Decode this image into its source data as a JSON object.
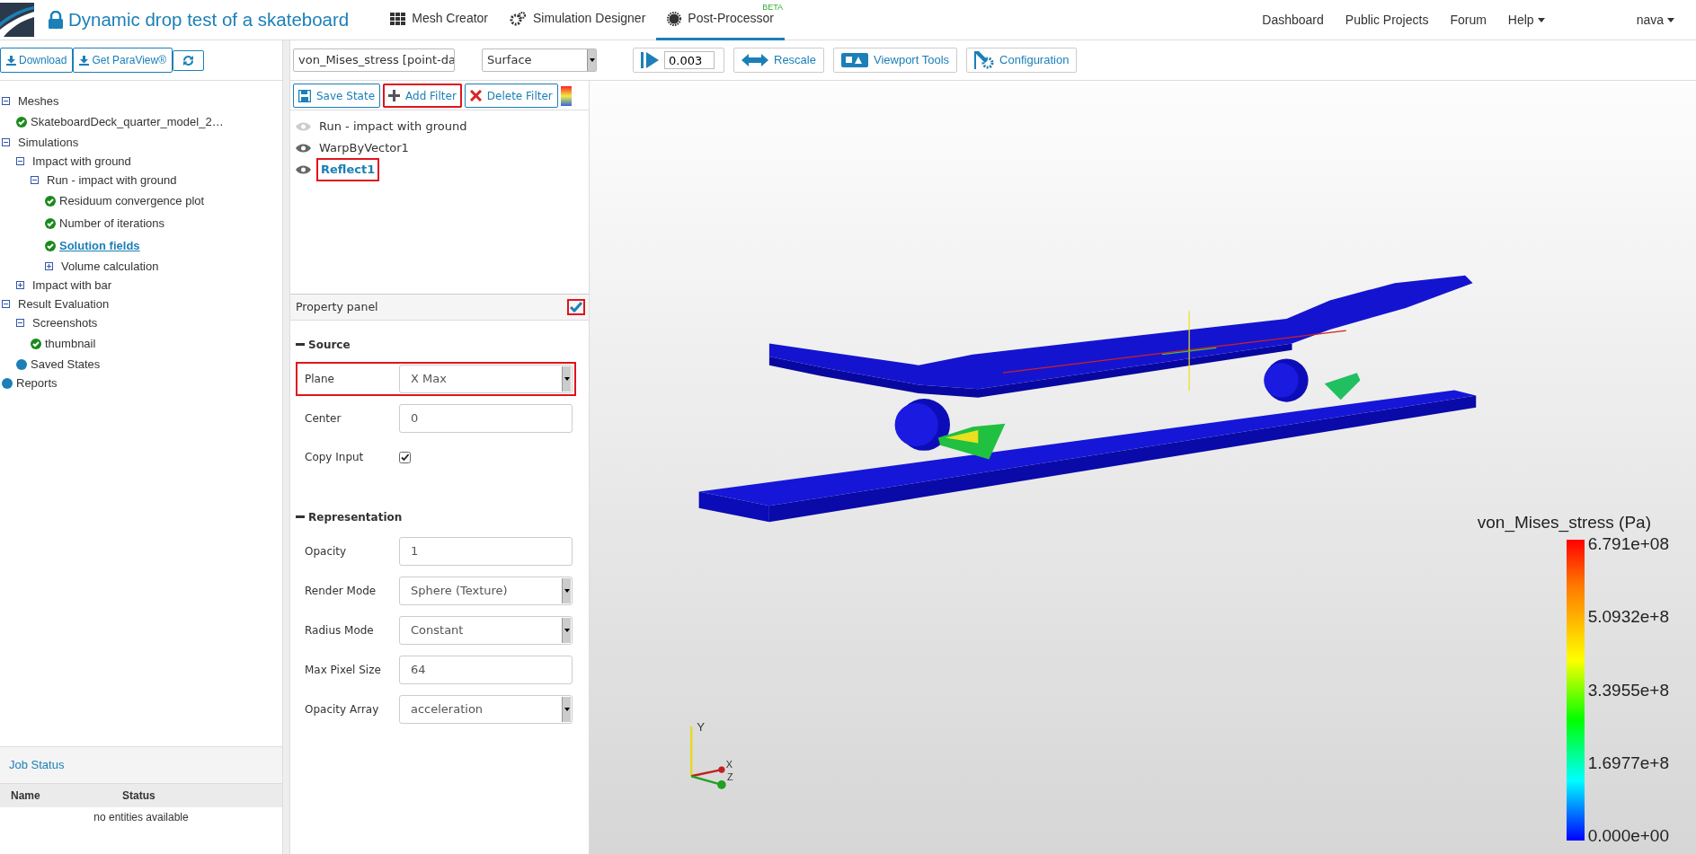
{
  "app": {
    "title": "Dynamic drop test of a skateboard",
    "locked": true
  },
  "modules": [
    {
      "label": "Mesh Creator",
      "selected": false
    },
    {
      "label": "Simulation Designer",
      "selected": false
    },
    {
      "label": "Post-Processor",
      "selected": true,
      "badge": "BETA"
    }
  ],
  "nav_links": [
    {
      "label": "Dashboard",
      "dropdown": false
    },
    {
      "label": "Public Projects",
      "dropdown": false
    },
    {
      "label": "Forum",
      "dropdown": false
    },
    {
      "label": "Help",
      "dropdown": true
    }
  ],
  "user": {
    "label": "nava",
    "dropdown": true
  },
  "sidebar": {
    "buttons": [
      {
        "kind": "labeled",
        "label": "Download"
      },
      {
        "kind": "labeled",
        "label": "Get ParaView®"
      },
      {
        "kind": "icon"
      }
    ],
    "tree": [
      {
        "label": "Meshes",
        "kind": "folder",
        "expanded": true,
        "selected": false,
        "children": [
          {
            "label": "SkateboardDeck_quarter_model_2…",
            "kind": "result",
            "selected": false
          }
        ]
      },
      {
        "label": "Simulations",
        "kind": "folder",
        "expanded": true,
        "selected": false,
        "children": [
          {
            "label": "Impact with ground",
            "kind": "folder",
            "expanded": true,
            "selected": false,
            "children": [
              {
                "label": "Run - impact with ground",
                "kind": "folder",
                "expanded": true,
                "selected": false,
                "children": [
                  {
                    "label": "Residuum convergence plot",
                    "kind": "result",
                    "selected": false
                  },
                  {
                    "label": "Number of iterations",
                    "kind": "result",
                    "selected": false
                  },
                  {
                    "label": "Solution fields",
                    "kind": "result",
                    "selected": true
                  },
                  {
                    "label": "Volume calculation",
                    "kind": "folder",
                    "expanded": false,
                    "selected": false
                  }
                ]
              }
            ]
          },
          {
            "label": "Impact with bar",
            "kind": "folder",
            "expanded": false,
            "selected": false
          }
        ]
      },
      {
        "label": "Result Evaluation",
        "kind": "folder",
        "expanded": true,
        "selected": false,
        "children": [
          {
            "label": "Screenshots",
            "kind": "folder",
            "expanded": true,
            "selected": false,
            "children": [
              {
                "label": "thumbnail",
                "kind": "result",
                "selected": false
              }
            ]
          },
          {
            "label": "Saved States",
            "kind": "group",
            "selected": false
          }
        ]
      },
      {
        "label": "Reports",
        "kind": "group",
        "selected": false
      }
    ]
  },
  "job_status": {
    "title": "Job Status",
    "columns": [
      "Name",
      "Status"
    ],
    "empty": "no entities available"
  },
  "toolbar": {
    "array_select": "von_Mises_stress [point-da",
    "representation_select": "Surface",
    "time": "0.003",
    "buttons": [
      {
        "label": "Rescale"
      },
      {
        "label": "Viewport Tools"
      },
      {
        "label": "Configuration"
      }
    ]
  },
  "filter_buttons": [
    {
      "label": "Save State",
      "highlighted": false
    },
    {
      "label": "Add Filter",
      "highlighted": true
    },
    {
      "label": "Delete Filter",
      "highlighted": false
    }
  ],
  "pipeline": [
    {
      "label": "Run - impact with ground",
      "visible": false,
      "selected": false,
      "highlighted": false
    },
    {
      "label": "WarpByVector1",
      "visible": true,
      "selected": false,
      "highlighted": false
    },
    {
      "label": "Reflect1",
      "visible": true,
      "selected": true,
      "highlighted": true
    }
  ],
  "property_panel": {
    "title": "Property panel",
    "checked": true,
    "highlighted": true,
    "sections": [
      {
        "title": "Source",
        "rows": [
          {
            "kind": "select",
            "label": "Plane",
            "value": "X Max",
            "highlighted": true
          },
          {
            "kind": "input",
            "label": "Center",
            "value": "0",
            "highlighted": false
          },
          {
            "kind": "checkbox",
            "label": "Copy Input",
            "checked": true,
            "highlighted": false
          }
        ]
      },
      {
        "title": "Representation",
        "rows": [
          {
            "kind": "input",
            "label": "Opacity",
            "value": "1",
            "highlighted": false
          },
          {
            "kind": "select",
            "label": "Render Mode",
            "value": "Sphere (Texture)",
            "highlighted": false
          },
          {
            "kind": "select",
            "label": "Radius Mode",
            "value": "Constant",
            "highlighted": false
          },
          {
            "kind": "input",
            "label": "Max Pixel Size",
            "value": "64",
            "highlighted": false
          },
          {
            "kind": "select",
            "label": "Opacity Array",
            "value": "acceleration",
            "highlighted": false
          }
        ]
      }
    ]
  },
  "viewport": {
    "legend": {
      "title": "von_Mises_stress (Pa)",
      "labels": [
        "6.791e+08",
        "5.0932e+8",
        "3.3955e+8",
        "1.6977e+8",
        "0.000e+00"
      ]
    },
    "axes": [
      "Y",
      "X",
      "Z"
    ]
  }
}
